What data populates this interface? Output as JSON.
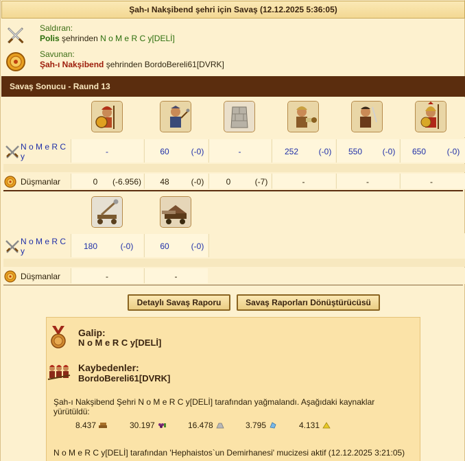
{
  "title": "Şah-ı Nakşibend şehri için Savaş (12.12.2025 5:36:05)",
  "attacker": {
    "label": "Saldıran:",
    "city": "Polis",
    "from_text": "şehrinden",
    "player": "N o M e R C y[DELİ]"
  },
  "defender": {
    "label": "Savunan:",
    "city": "Şah-ı Nakşibend",
    "from_text": "şehrinden",
    "player": "BordoBereli61[DVRK]"
  },
  "section_title": "Savaş Sonucu - Raund 13",
  "table1": {
    "units": [
      "hoplite-icon",
      "slinger-icon",
      "wall-icon",
      "swordsman-icon",
      "archer-icon",
      "spartan-icon"
    ],
    "player_name": "N o M e R C y",
    "player_values": [
      {
        "v": "-",
        "d": ""
      },
      {
        "v": "60",
        "d": "(-0)"
      },
      {
        "v": "-",
        "d": ""
      },
      {
        "v": "252",
        "d": "(-0)"
      },
      {
        "v": "550",
        "d": "(-0)"
      },
      {
        "v": "650",
        "d": "(-0)"
      }
    ],
    "enemy_label": "Düşmanlar",
    "enemy_values": [
      {
        "v": "0",
        "d": "(-6.956)"
      },
      {
        "v": "48",
        "d": "(-0)"
      },
      {
        "v": "0",
        "d": "(-7)"
      },
      {
        "v": "-",
        "d": ""
      },
      {
        "v": "-",
        "d": ""
      },
      {
        "v": "-",
        "d": ""
      }
    ]
  },
  "table2": {
    "units": [
      "catapult-icon",
      "ram-icon"
    ],
    "player_name": "N o M e R C y",
    "player_values": [
      {
        "v": "180",
        "d": "(-0)"
      },
      {
        "v": "60",
        "d": "(-0)"
      }
    ],
    "enemy_label": "Düşmanlar",
    "enemy_values": [
      {
        "v": "-",
        "d": ""
      },
      {
        "v": "-",
        "d": ""
      }
    ]
  },
  "buttons": {
    "detailed": "Detaylı Savaş Raporu",
    "converter": "Savaş Raporları Dönüştürücüsü"
  },
  "result": {
    "winner_label": "Galip:",
    "winner": "N o M e R C y[DELİ]",
    "loser_label": "Kaybedenler:",
    "loser": "BordoBereli61[DVRK]",
    "plunder_text": "Şah-ı Nakşibend Şehri N o M e R C y[DELİ] tarafından yağmalandı. Aşağıdaki kaynaklar yürütüldü:",
    "resources": [
      {
        "value": "8.437",
        "icon": "wood-icon"
      },
      {
        "value": "30.197",
        "icon": "grapes-icon"
      },
      {
        "value": "16.478",
        "icon": "marble-icon"
      },
      {
        "value": "3.795",
        "icon": "crystal-icon"
      },
      {
        "value": "4.131",
        "icon": "sulfur-icon"
      }
    ],
    "wonder_text": "N o M e R C y[DELİ] tarafından 'Hephaistos`un Demirhanesi' mucizesi aktif (12.12.2025 3:21:05)"
  }
}
